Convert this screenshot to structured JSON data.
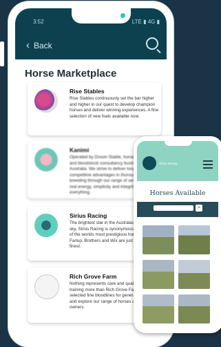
{
  "status": {
    "time": "3:52",
    "icons": "LTE ▮ 4G ▮"
  },
  "appbar": {
    "back_label": "Back"
  },
  "page": {
    "title": "Horse Marketplace"
  },
  "cards": [
    {
      "name": "Rise Stables",
      "desc": "Rise Stables continuously set the bar higher and higher in our quest to develop champion horses and deliver winning experiences. A fine selection of new foals available now."
    },
    {
      "name": "Kanimi",
      "desc": "Operated by Drouin Stable, horses at a well and bloodstock consultancy business based in Australia. We strive to deliver long term competitive advantages in thoroughbred breeding through our range of services. Pay a real energy, simplicity and integrity are everything."
    },
    {
      "name": "Sirius Racing",
      "desc": "The brightest star in the Australasian racing sky, Sirius Racing is synonymous with winners of the worlds most prestigious horse races - Farlup, Brothers and Wix are just some of our finest."
    },
    {
      "name": "Rich Grove Farm",
      "desc": "Nothing represents care and quality in equine training more than Rich Grove Farm. We have selected fine bloodlines for generations. Come and explore our range of horses available for owners."
    }
  ],
  "second_phone": {
    "brand": "Sirius Racing",
    "title": "Horses Available"
  },
  "colors": {
    "primary": "#0d4150",
    "mint": "#8fd3c3",
    "background": "#1b3346"
  }
}
